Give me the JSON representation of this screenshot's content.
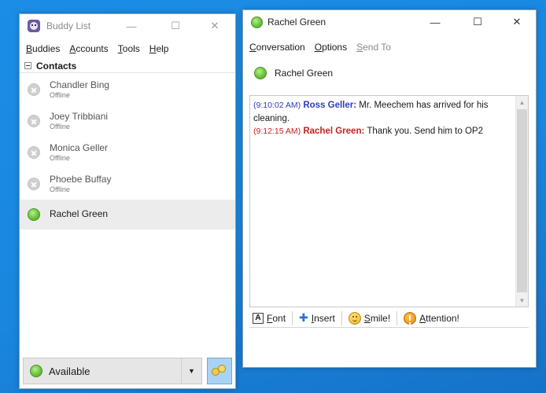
{
  "buddy_list": {
    "title": "Buddy List",
    "menu": [
      {
        "mnemonic": "B",
        "rest": "uddies"
      },
      {
        "mnemonic": "A",
        "rest": "ccounts"
      },
      {
        "mnemonic": "T",
        "rest": "ools"
      },
      {
        "mnemonic": "H",
        "rest": "elp"
      }
    ],
    "group_label": "Contacts",
    "buddies": [
      {
        "name": "Chandler Bing",
        "status": "Offline"
      },
      {
        "name": "Joey Tribbiani",
        "status": "Offline"
      },
      {
        "name": "Monica Geller",
        "status": "Offline"
      },
      {
        "name": "Phoebe Buffay",
        "status": "Offline"
      },
      {
        "name": "Rachel Green",
        "status": ""
      }
    ],
    "status_selector": {
      "value": "Available"
    }
  },
  "conversation": {
    "title": "Rachel Green",
    "menu": [
      {
        "mnemonic": "C",
        "rest": "onversation"
      },
      {
        "mnemonic": "O",
        "rest": "ptions"
      },
      {
        "mnemonic": "S",
        "rest": "end To"
      }
    ],
    "buddy_name": "Rachel Green",
    "messages": [
      {
        "time": "(9:10:02 AM)",
        "sender": "Ross Geller:",
        "text": "Mr. Meechem has arrived for his cleaning."
      },
      {
        "time": "(9:12:15 AM)",
        "sender": "Rachel Green:",
        "text": "Thank you. Send him to OP2"
      }
    ],
    "toolbar": {
      "font": {
        "mnemonic": "F",
        "rest": "ont"
      },
      "insert": {
        "mnemonic": "I",
        "rest": "nsert"
      },
      "smile": {
        "mnemonic": "S",
        "rest": "mile!"
      },
      "attention": {
        "mnemonic": "A",
        "rest": "ttention!"
      }
    }
  },
  "window_controls": {
    "minimize": "—",
    "maximize": "☐",
    "close": "✕"
  },
  "icons": {
    "offline": "offline-status-icon",
    "available": "available-status-icon",
    "app": "pidgin-icon",
    "font": "font-icon",
    "insert": "insert-icon",
    "smile": "smiley-icon",
    "attention": "attention-icon",
    "pounce": "buddy-pounce-icon"
  },
  "colors": {
    "desktop": "#1e8fe6",
    "ross": "#2b3eb5",
    "rachel": "#c42222",
    "available": "#6cc43a"
  }
}
